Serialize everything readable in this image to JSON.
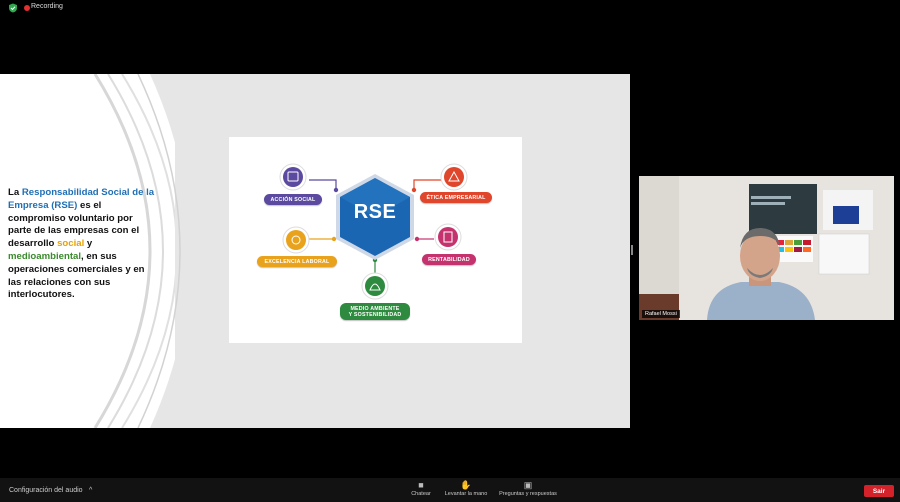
{
  "top_bar": {
    "recording_label": "Recording"
  },
  "slide": {
    "text_parts": [
      {
        "text": "La ",
        "style": "plain"
      },
      {
        "text": "Responsabilidad Social de la Empresa (RSE)",
        "style": "blue"
      },
      {
        "text": " es el compromiso voluntario por parte de las empresas con el desarrollo ",
        "style": "plain"
      },
      {
        "text": "social",
        "style": "orange"
      },
      {
        "text": " y ",
        "style": "plain"
      },
      {
        "text": "medioambiental",
        "style": "green"
      },
      {
        "text": ", en sus operaciones comerciales y en las relaciones con sus interlocutores.",
        "style": "plain"
      }
    ],
    "graphic": {
      "center": "RSE",
      "items": {
        "accion_social": "ACCIÓN SOCIAL",
        "excelencia_laboral": "EXCELENCIA LABORAL",
        "medio_ambiente_1": "MEDIO AMBIENTE",
        "medio_ambiente_2": "Y SOSTENIBILIDAD",
        "etica_empresarial": "ÉTICA EMPRESARIAL",
        "rentabilidad": "RENTABILIDAD"
      },
      "colors": {
        "hex": "#1a66b2",
        "accion": "#5b4aa0",
        "excelencia": "#e9a21c",
        "medio": "#2e8a3e",
        "etica": "#e0462b",
        "rentabilidad": "#c4336e"
      }
    }
  },
  "camera": {
    "participant_name": "Rafael Mossi"
  },
  "bottom_bar": {
    "audio_settings": "Configuración del audio",
    "chat": "Chatear",
    "raise_hand": "Levantar la mano",
    "qa": "Preguntas y respuestas",
    "leave": "Sair"
  }
}
